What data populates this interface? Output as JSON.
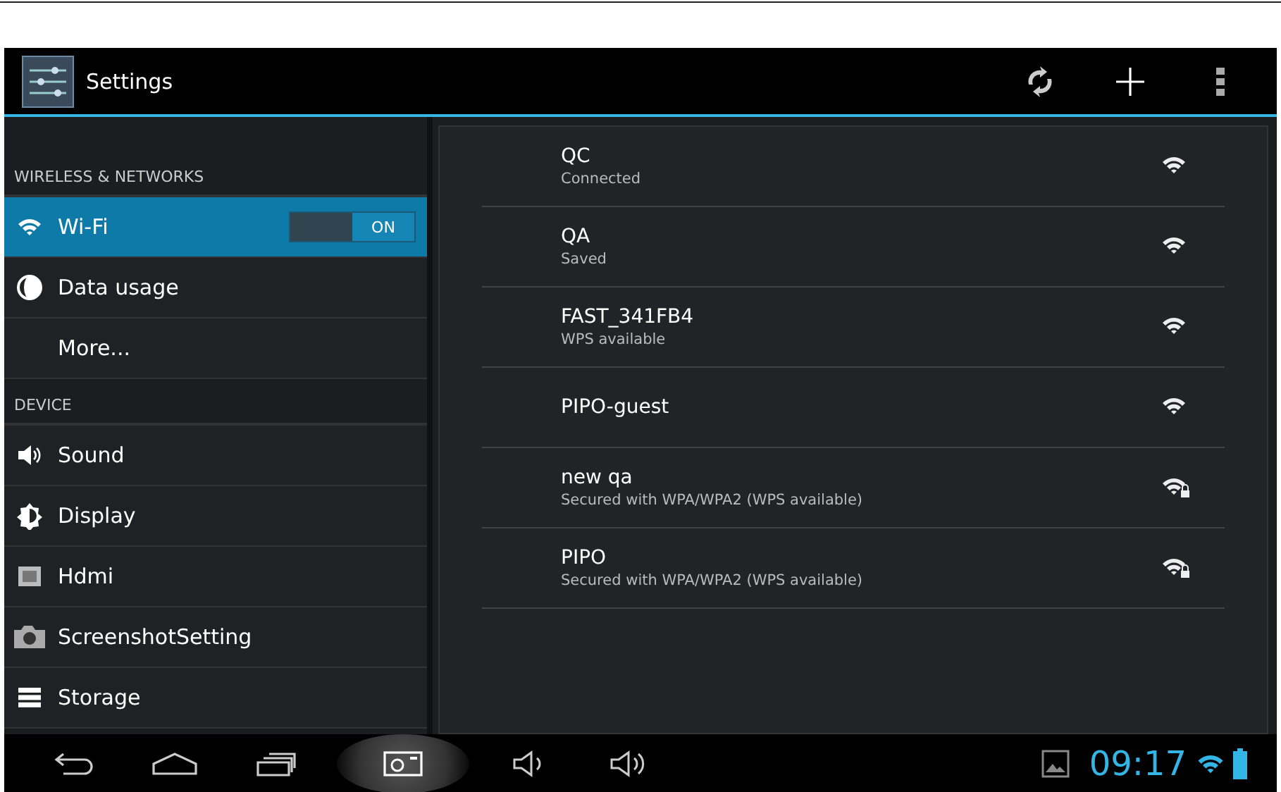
{
  "action_bar": {
    "title": "Settings"
  },
  "sidebar": [
    {
      "kind": "header",
      "label": "WIRELESS & NETWORKS"
    },
    {
      "kind": "wifi",
      "label": "Wi-Fi",
      "selected": true,
      "toggle": {
        "label": "ON",
        "on": true
      }
    },
    {
      "kind": "data",
      "label": "Data usage",
      "selected": false
    },
    {
      "kind": "plain",
      "label": "More...",
      "selected": false
    },
    {
      "kind": "header",
      "label": "DEVICE"
    },
    {
      "kind": "sound",
      "label": "Sound",
      "selected": false
    },
    {
      "kind": "display",
      "label": "Display",
      "selected": false
    },
    {
      "kind": "hdmi",
      "label": "Hdmi",
      "selected": false
    },
    {
      "kind": "camera",
      "label": "ScreenshotSetting",
      "selected": false
    },
    {
      "kind": "storage",
      "label": "Storage",
      "selected": false
    }
  ],
  "networks": [
    {
      "name": "QC",
      "status": "Connected",
      "locked": false
    },
    {
      "name": "QA",
      "status": "Saved",
      "locked": false
    },
    {
      "name": "FAST_341FB4",
      "status": "WPS available",
      "locked": false
    },
    {
      "name": "PIPO-guest",
      "locked": false
    },
    {
      "name": "new qa",
      "status": "Secured with WPA/WPA2 (WPS available)",
      "locked": true
    },
    {
      "name": "PIPO",
      "status": "Secured with WPA/WPA2 (WPS available)",
      "locked": true
    }
  ],
  "status_bar": {
    "time": "09:17"
  }
}
